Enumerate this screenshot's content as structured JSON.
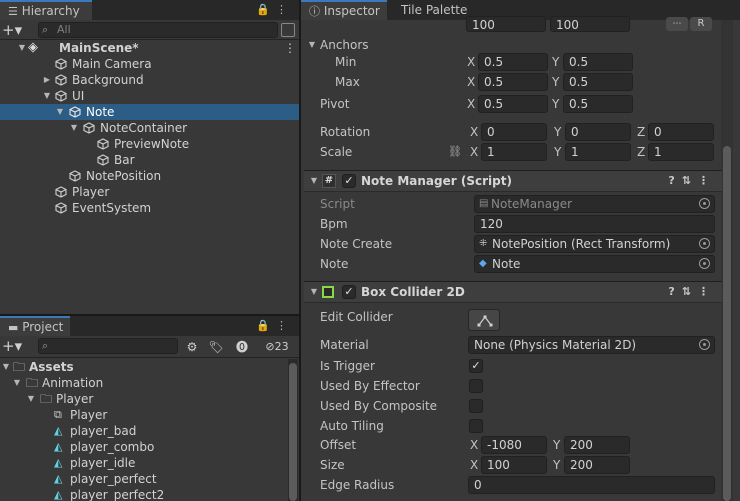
{
  "hierarchy": {
    "tab": "Hierarchy",
    "search_placeholder": "All",
    "scene": "MainScene*",
    "items": [
      {
        "label": "Main Camera"
      },
      {
        "label": "Background"
      },
      {
        "label": "UI"
      },
      {
        "label": "Note"
      },
      {
        "label": "NoteContainer"
      },
      {
        "label": "PreviewNote"
      },
      {
        "label": "Bar"
      },
      {
        "label": "NotePosition"
      },
      {
        "label": "Player"
      },
      {
        "label": "EventSystem"
      }
    ]
  },
  "project": {
    "tab": "Project",
    "hidden_count": "23",
    "items": [
      {
        "label": "Assets"
      },
      {
        "label": "Animation"
      },
      {
        "label": "Player"
      },
      {
        "label": "Player"
      },
      {
        "label": "player_bad"
      },
      {
        "label": "player_combo"
      },
      {
        "label": "player_idle"
      },
      {
        "label": "player_perfect"
      },
      {
        "label": "player_perfect2"
      }
    ]
  },
  "inspector": {
    "tabs": [
      "Inspector",
      "Tile Palette"
    ],
    "rect": {
      "width": "100",
      "height": "100",
      "raw_btn": "R",
      "anchors": "Anchors",
      "min": "Min",
      "max": "Max",
      "min_x": "0.5",
      "min_y": "0.5",
      "max_x": "0.5",
      "max_y": "0.5",
      "pivot": "Pivot",
      "pivot_x": "0.5",
      "pivot_y": "0.5",
      "rotation": "Rotation",
      "rot_x": "0",
      "rot_y": "0",
      "rot_z": "0",
      "scale": "Scale",
      "scale_x": "1",
      "scale_y": "1",
      "scale_z": "1"
    },
    "note_manager": {
      "title": "Note Manager (Script)",
      "script_label": "Script",
      "script_value": "NoteManager",
      "bpm_label": "Bpm",
      "bpm_value": "120",
      "note_create_label": "Note Create",
      "note_create_value": "NotePosition (Rect Transform)",
      "note_label": "Note",
      "note_value": "Note"
    },
    "box_collider": {
      "title": "Box Collider 2D",
      "edit_collider": "Edit Collider",
      "material_label": "Material",
      "material_value": "None (Physics Material 2D)",
      "is_trigger": "Is Trigger",
      "used_by_effector": "Used By Effector",
      "used_by_composite": "Used By Composite",
      "auto_tiling": "Auto Tiling",
      "offset_label": "Offset",
      "offset_x": "-1080",
      "offset_y": "200",
      "size_label": "Size",
      "size_x": "100",
      "size_y": "200",
      "edge_radius_label": "Edge Radius",
      "edge_radius": "0"
    },
    "axes": {
      "x": "X",
      "y": "Y",
      "z": "Z"
    }
  }
}
